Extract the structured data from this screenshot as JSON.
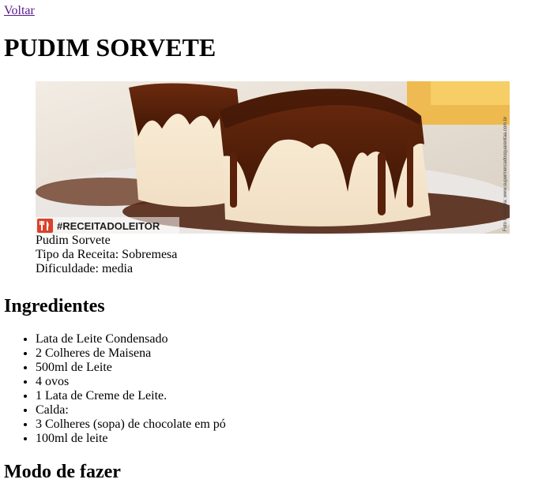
{
  "nav": {
    "back_label": "Voltar"
  },
  "recipe": {
    "title": "PUDIM SORVETE",
    "photo": {
      "overlay_tag": "#RECEITADOLEITOR",
      "credit_text": "Foto Ilustrativa: www.supermercadosquarentaa.com.br",
      "icon": "fork-knife-icon"
    },
    "name": "Pudim Sorvete",
    "type_label": "Tipo da Receita: Sobremesa",
    "difficulty_label": "Dificuldade: media"
  },
  "ingredients": {
    "heading": "Ingredientes",
    "items": [
      "Lata de Leite Condensado",
      "2 Colheres de Maisena",
      "500ml de Leite",
      "4 ovos",
      "1 Lata de Creme de Leite.",
      "Calda:",
      "3 Colheres (sopa) de chocolate em pó",
      "100ml de leite"
    ]
  },
  "method": {
    "heading": "Modo de fazer"
  }
}
